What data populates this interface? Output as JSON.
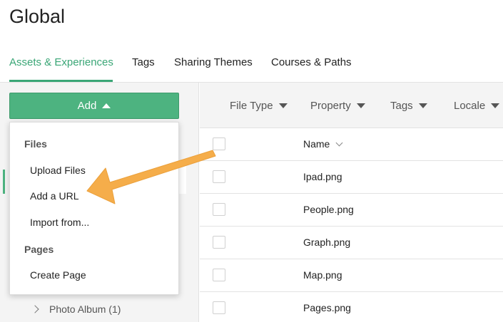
{
  "page": {
    "title": "Global"
  },
  "tabs": [
    {
      "label": "Assets & Experiences",
      "active": true
    },
    {
      "label": "Tags"
    },
    {
      "label": "Sharing Themes"
    },
    {
      "label": "Courses & Paths"
    }
  ],
  "sidebar": {
    "add_label": "Add",
    "items": [
      {
        "label": "Photo Album (1)"
      }
    ]
  },
  "menu": {
    "files_heading": "Files",
    "upload_files": "Upload Files",
    "add_url": "Add a URL",
    "import_from": "Import from...",
    "pages_heading": "Pages",
    "create_page": "Create Page"
  },
  "filters": [
    {
      "label": "File Type"
    },
    {
      "label": "Property"
    },
    {
      "label": "Tags"
    },
    {
      "label": "Locale"
    }
  ],
  "table": {
    "name_header": "Name",
    "rows": [
      {
        "name": "Ipad.png"
      },
      {
        "name": "People.png"
      },
      {
        "name": "Graph.png"
      },
      {
        "name": "Map.png"
      },
      {
        "name": "Pages.png"
      }
    ]
  },
  "colors": {
    "accent": "#3aa676",
    "button": "#4db380",
    "annotation_arrow": "#f5ad4a"
  },
  "icons": {
    "add_caret": "caret-up-icon",
    "filter_caret": "caret-down-icon",
    "sort": "chevron-down-icon",
    "expand": "chevron-right-icon"
  }
}
